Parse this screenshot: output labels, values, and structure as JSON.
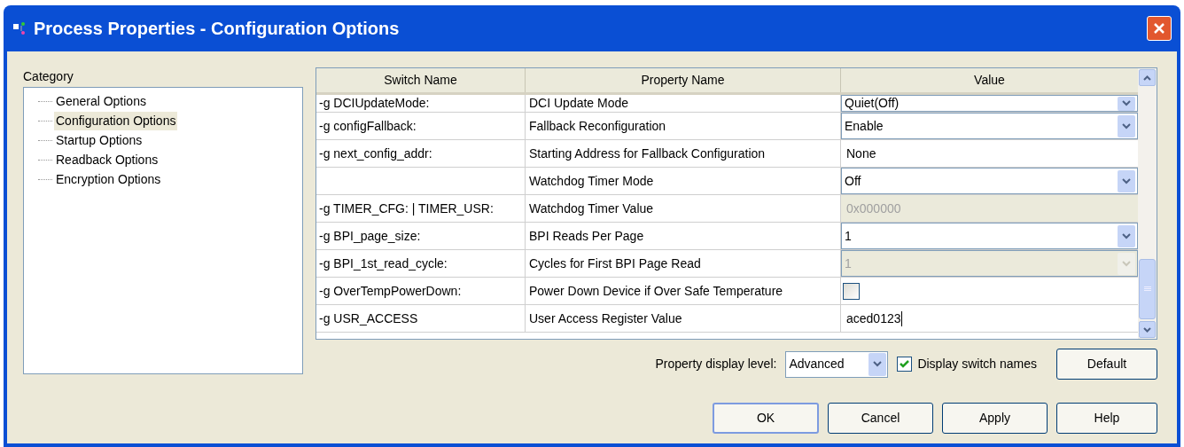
{
  "window": {
    "title": "Process Properties - Configuration Options"
  },
  "category": {
    "label": "Category",
    "items": [
      {
        "label": "General Options",
        "selected": false
      },
      {
        "label": "Configuration Options",
        "selected": true
      },
      {
        "label": "Startup Options",
        "selected": false
      },
      {
        "label": "Readback Options",
        "selected": false
      },
      {
        "label": "Encryption Options",
        "selected": false
      }
    ]
  },
  "table": {
    "columns": [
      "Switch Name",
      "Property Name",
      "Value"
    ],
    "rows": [
      {
        "switch": "-g DCIUpdateMode:",
        "property": "DCI Update Mode",
        "value": {
          "kind": "select",
          "text": "Quiet(Off)",
          "disabled": false
        }
      },
      {
        "switch": "-g configFallback:",
        "property": "Fallback Reconfiguration",
        "value": {
          "kind": "select",
          "text": "Enable",
          "disabled": false
        }
      },
      {
        "switch": "-g next_config_addr:",
        "property": "Starting Address for Fallback Configuration",
        "value": {
          "kind": "text",
          "text": "None",
          "disabled": false
        }
      },
      {
        "switch": "",
        "property": "Watchdog Timer Mode",
        "value": {
          "kind": "select",
          "text": "Off",
          "disabled": false
        }
      },
      {
        "switch": "-g TIMER_CFG: | TIMER_USR:",
        "property": "Watchdog Timer Value",
        "value": {
          "kind": "text",
          "text": "0x000000",
          "disabled": true
        }
      },
      {
        "switch": "-g BPI_page_size:",
        "property": "BPI Reads Per Page",
        "value": {
          "kind": "select",
          "text": "1",
          "disabled": false
        }
      },
      {
        "switch": "-g BPI_1st_read_cycle:",
        "property": "Cycles for First BPI Page Read",
        "value": {
          "kind": "select",
          "text": "1",
          "disabled": true
        }
      },
      {
        "switch": "-g OverTempPowerDown:",
        "property": "Power Down Device if Over Safe Temperature",
        "value": {
          "kind": "checkbox",
          "checked": false
        }
      },
      {
        "switch": "-g USR_ACCESS",
        "property": "User Access Register Value",
        "value": {
          "kind": "text",
          "text": "aced0123",
          "disabled": false,
          "focused": true
        }
      }
    ]
  },
  "display_level": {
    "label": "Property display level:",
    "value": "Advanced"
  },
  "display_switch_names": {
    "label": "Display switch names",
    "checked": true
  },
  "buttons": [
    "Default",
    "OK",
    "Cancel",
    "Apply",
    "Help"
  ]
}
